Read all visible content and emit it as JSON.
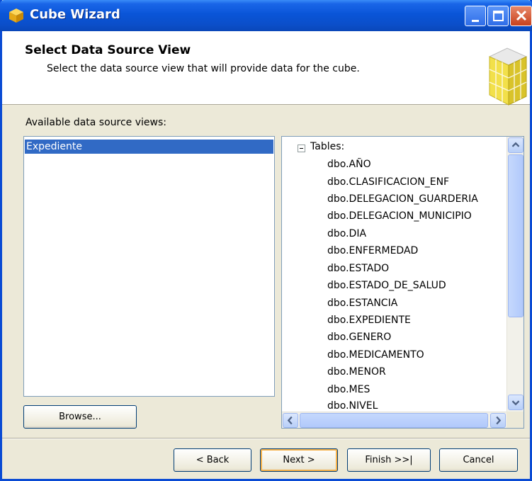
{
  "window": {
    "title": "Cube Wizard",
    "accent_color": "#0a55d8"
  },
  "header": {
    "title": "Select Data Source View",
    "subtitle": "Select the data source view that will provide data for the cube."
  },
  "available": {
    "label": "Available data source views:",
    "items": [
      "Expediente"
    ],
    "selected_index": 0
  },
  "browse_button": "Browse...",
  "tree": {
    "root_label": "Tables:",
    "items": [
      "dbo.AÑO",
      "dbo.CLASIFICACION_ENF",
      "dbo.DELEGACION_GUARDERIA",
      "dbo.DELEGACION_MUNICIPIO",
      "dbo.DIA",
      "dbo.ENFERMEDAD",
      "dbo.ESTADO",
      "dbo.ESTADO_DE_SALUD",
      "dbo.ESTANCIA",
      "dbo.EXPEDIENTE",
      "dbo.GENERO",
      "dbo.MEDICAMENTO",
      "dbo.MENOR",
      "dbo.MES",
      "dbo.NIVEL"
    ]
  },
  "footer": {
    "back": "< Back",
    "next": "Next >",
    "finish": "Finish >>|",
    "cancel": "Cancel"
  }
}
